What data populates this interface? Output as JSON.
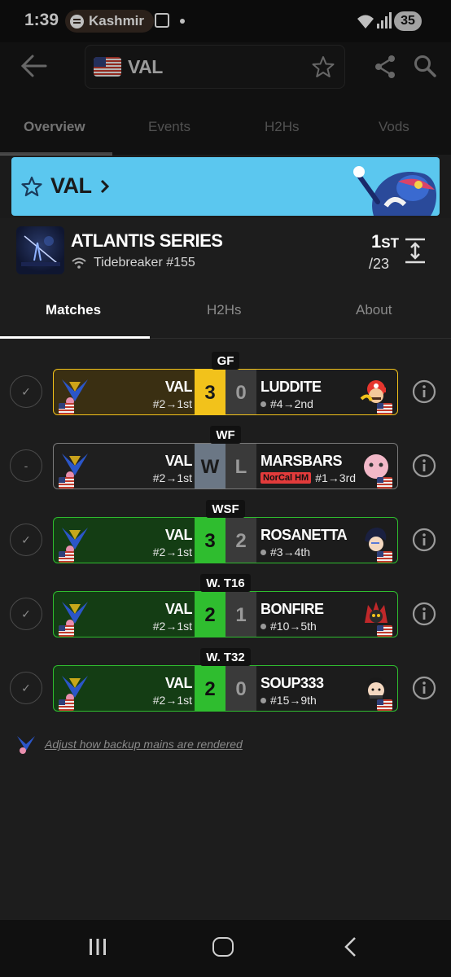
{
  "status_bar": {
    "time": "1:39",
    "media_app": "Kashmir",
    "battery": "35"
  },
  "app_bar": {
    "search_value": "VAL"
  },
  "top_tabs": [
    {
      "label": "Overview",
      "active": true
    },
    {
      "label": "Events",
      "active": false
    },
    {
      "label": "H2Hs",
      "active": false
    },
    {
      "label": "Vods",
      "active": false
    }
  ],
  "banner": {
    "title": "VAL",
    "color": "#5bc7ef"
  },
  "event": {
    "name": "ATLANTIS SERIES",
    "subtitle": "Tidebreaker #155",
    "placement": "1",
    "placement_suffix": "ST",
    "entrants": "/23"
  },
  "event_tabs": [
    {
      "label": "Matches",
      "active": true
    },
    {
      "label": "H2Hs",
      "active": false
    },
    {
      "label": "About",
      "active": false
    }
  ],
  "matches": [
    {
      "round": "GF",
      "status": "✓",
      "p1_name": "VAL",
      "p1_seed": "#2→1st",
      "p1_score": "3",
      "p2_name": "LUDDITE",
      "p2_seed": "#4→2nd",
      "p2_score": "0",
      "p2_badge": "",
      "result": "gold"
    },
    {
      "round": "WF",
      "status": "-",
      "p1_name": "VAL",
      "p1_seed": "#2→1st",
      "p1_score": "W",
      "p2_name": "MARSBARS",
      "p2_seed": "#1→3rd",
      "p2_score": "L",
      "p2_badge": "NorCal HM",
      "result": "dq"
    },
    {
      "round": "WSF",
      "status": "✓",
      "p1_name": "VAL",
      "p1_seed": "#2→1st",
      "p1_score": "3",
      "p2_name": "ROSANETTA",
      "p2_seed": "#3→4th",
      "p2_score": "2",
      "p2_badge": "",
      "result": "win"
    },
    {
      "round": "W. T16",
      "status": "✓",
      "p1_name": "VAL",
      "p1_seed": "#2→1st",
      "p1_score": "2",
      "p2_name": "BONFIRE",
      "p2_seed": "#10→5th",
      "p2_score": "1",
      "p2_badge": "",
      "result": "win"
    },
    {
      "round": "W. T32",
      "status": "✓",
      "p1_name": "VAL",
      "p1_seed": "#2→1st",
      "p1_score": "2",
      "p2_name": "SOUP333",
      "p2_seed": "#15→9th",
      "p2_score": "0",
      "p2_badge": "",
      "result": "win"
    }
  ],
  "footer": {
    "link": "Adjust how backup mains are rendered"
  },
  "colors": {
    "gold": "#f2c21b",
    "win": "#2fbd2f",
    "dq": "#6b7785"
  }
}
